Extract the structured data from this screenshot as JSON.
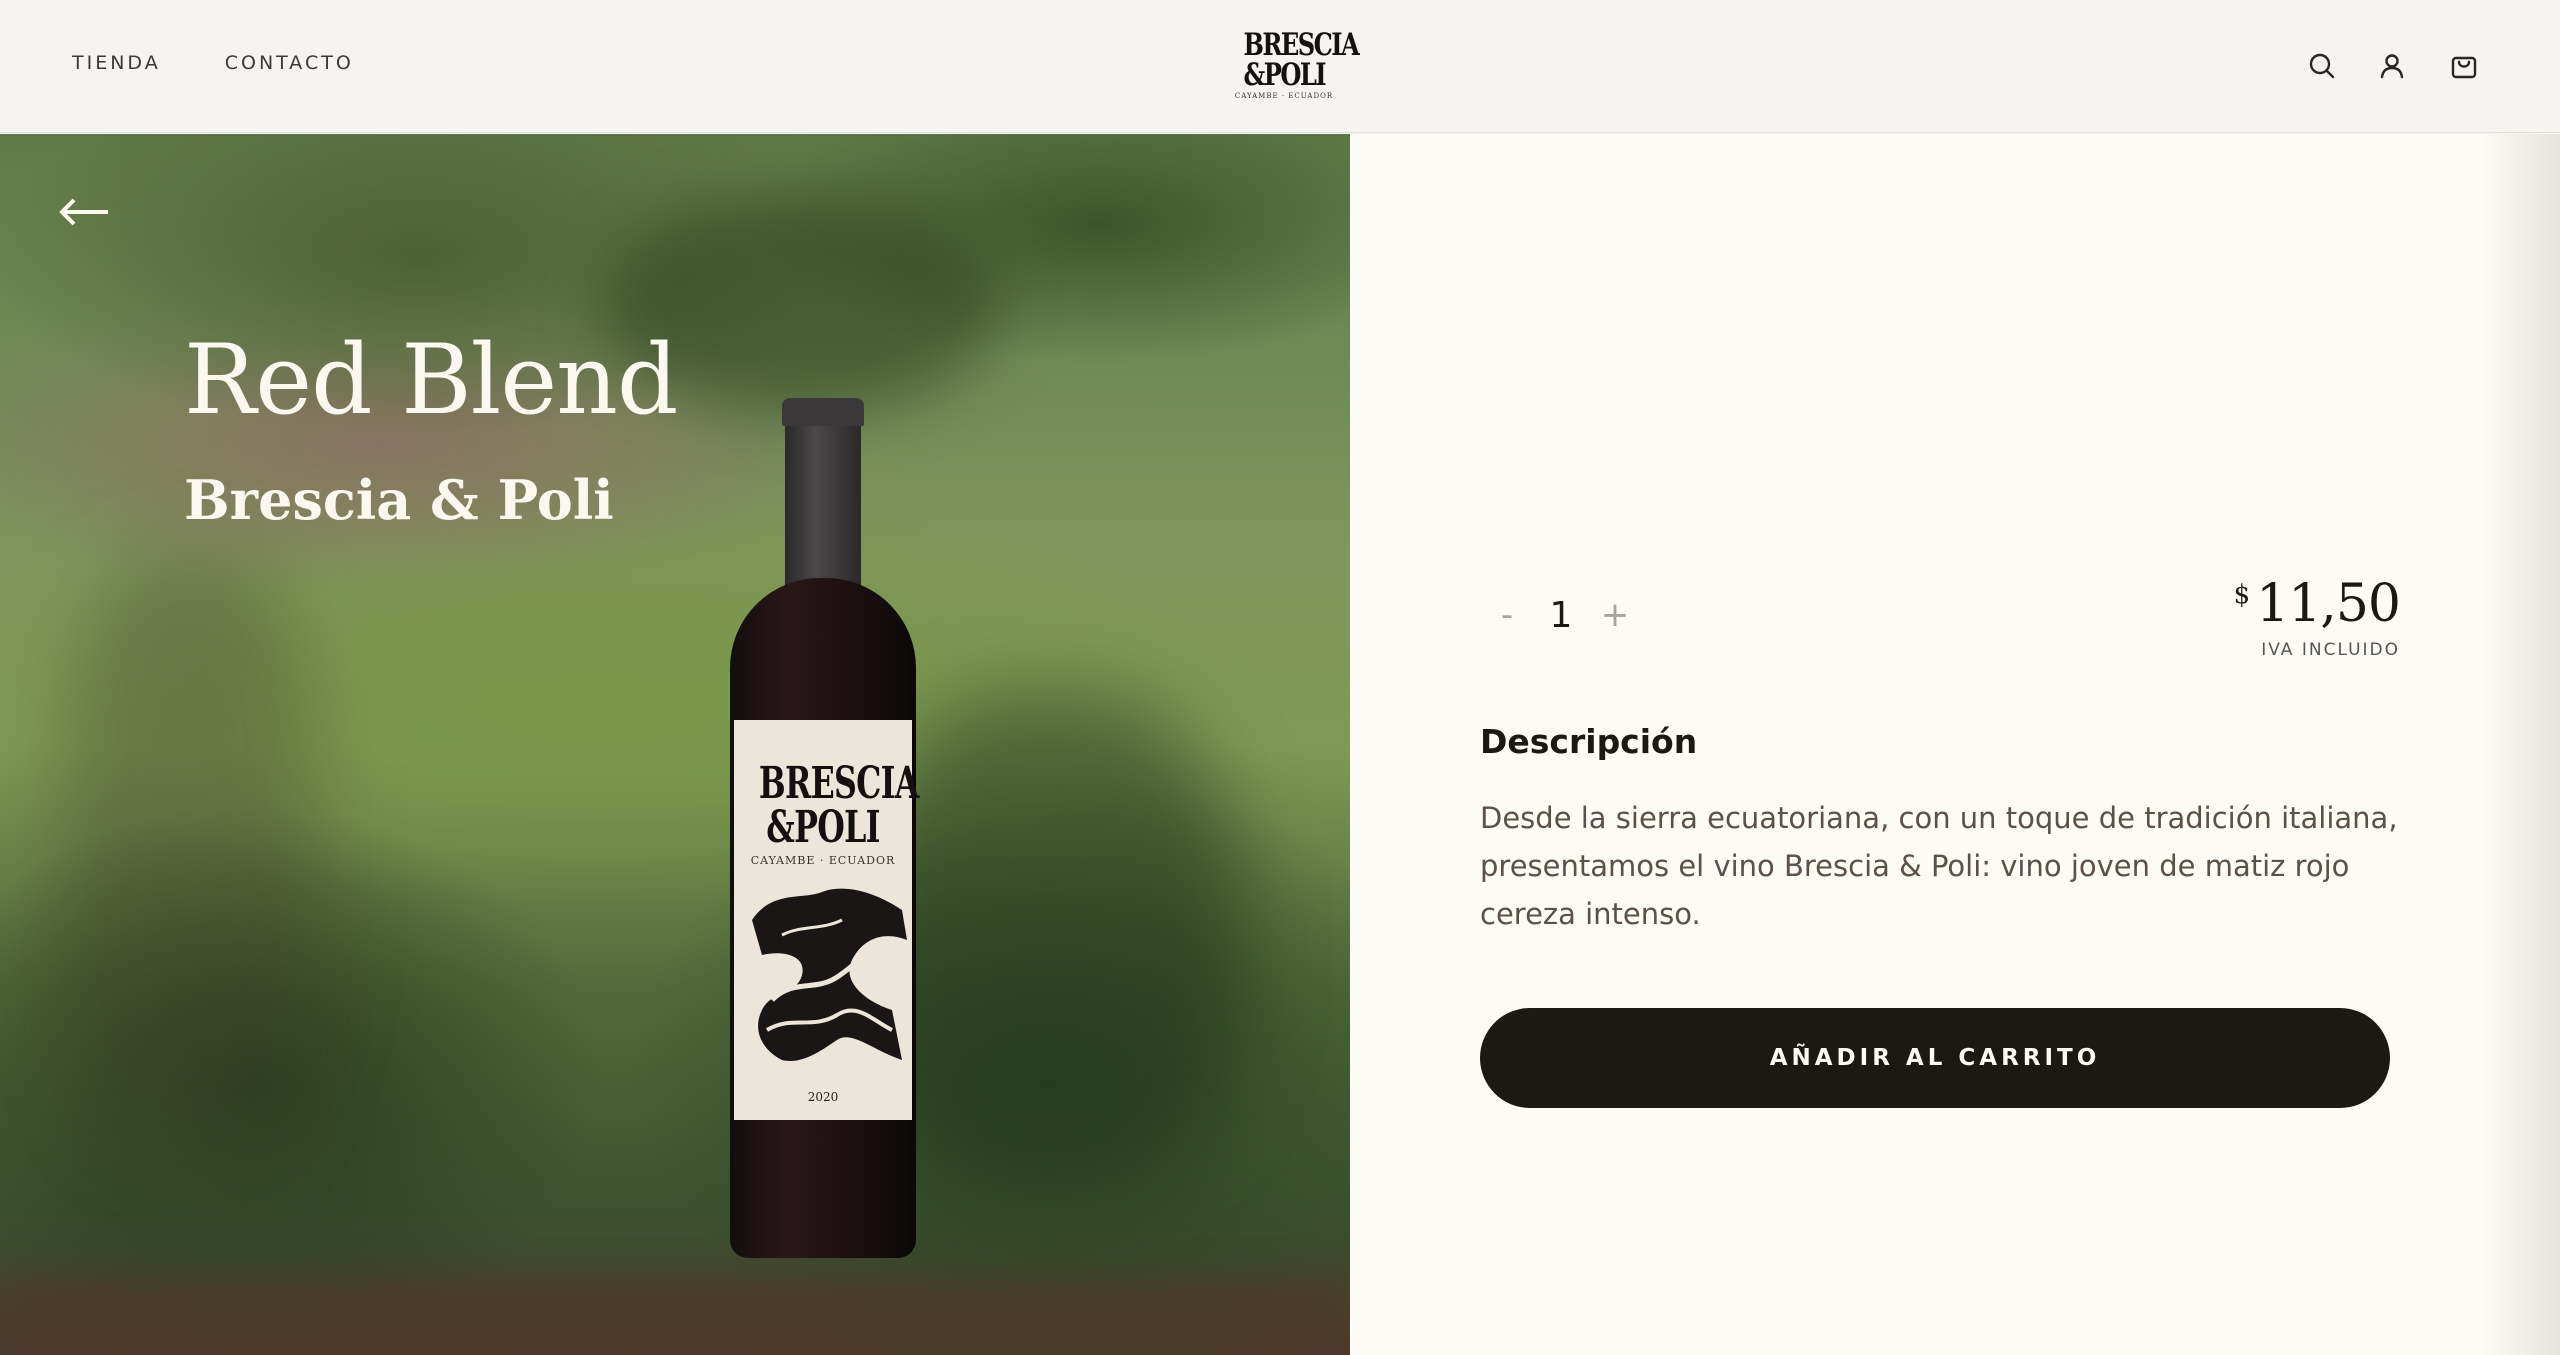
{
  "header": {
    "nav": [
      {
        "label": "TIENDA"
      },
      {
        "label": "CONTACTO"
      }
    ],
    "logo": {
      "line1": "BRESCIA",
      "line2": "&POLI",
      "line3": "CAYAMBE · ECUADOR"
    },
    "icons": [
      "search-icon",
      "user-icon",
      "cart-icon"
    ]
  },
  "hero": {
    "back_icon": "arrow-left-icon",
    "title": "Red Blend",
    "subtitle": "Brescia & Poli",
    "bottle_label": {
      "line1": "BRESCIA",
      "line2": "&POLI",
      "line3": "CAYAMBE · ECUADOR",
      "year": "2020"
    }
  },
  "product": {
    "quantity": {
      "minus": "-",
      "value": "1",
      "plus": "+"
    },
    "price": {
      "currency": "$",
      "amount": "11,50",
      "tax_note": "IVA INCLUIDO"
    },
    "description_title": "Descripción",
    "description": "Desde la sierra ecuatoriana, con un toque de tradición italiana, presentamos el vino Brescia & Poli: vino joven de matiz rojo cereza intenso.",
    "add_to_cart": "AÑADIR AL CARRITO"
  },
  "colors": {
    "header_bg": "#f5f4f0",
    "panel_bg": "#fdfbf5",
    "button_bg": "#1c1814",
    "text_dark": "#1c1814"
  }
}
